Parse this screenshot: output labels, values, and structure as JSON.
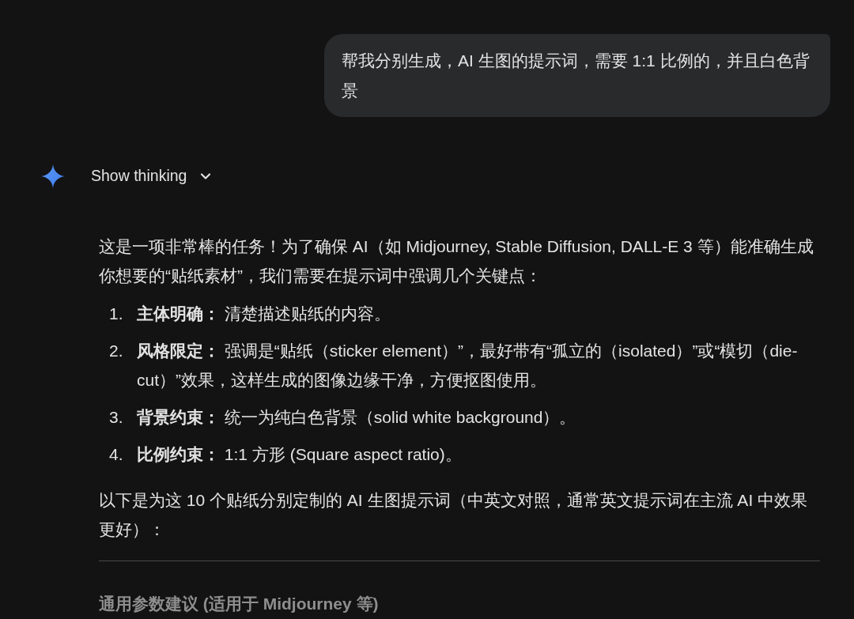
{
  "user_message": {
    "text": "帮我分别生成，AI 生图的提示词，需要 1:1 比例的，并且白色背景"
  },
  "response": {
    "thinking_toggle": {
      "label": "Show thinking",
      "expanded": false
    },
    "intro": "这是一项非常棒的任务！为了确保 AI（如 Midjourney, Stable Diffusion, DALL-E 3 等）能准确生成你想要的“贴纸素材”，我们需要在提示词中强调几个关键点：",
    "points": [
      {
        "number": "1.",
        "text": "**主体明确：** 清楚描述贴纸的内容。"
      },
      {
        "number": "2.",
        "text": "**风格限定：** 强调是“贴纸（sticker element）”，最好带有“孤立的（isolated）”或“模切（die-cut）”效果，这样生成的图像边缘干净，方便抠图使用。"
      },
      {
        "number": "3.",
        "text": "**背景约束：** 统一为纯白色背景（solid white background）。"
      },
      {
        "number": "4.",
        "text": "**比例约束：** 1:1 方形 (Square aspect ratio)。"
      }
    ],
    "outro": "以下是为这 10 个贴纸分别定制的 AI 生图提示词（中英文对照，通常英文提示词在主流 AI 中效果更好）：",
    "section_heading": "通用参数建议 (适用于 Midjourney 等)"
  }
}
